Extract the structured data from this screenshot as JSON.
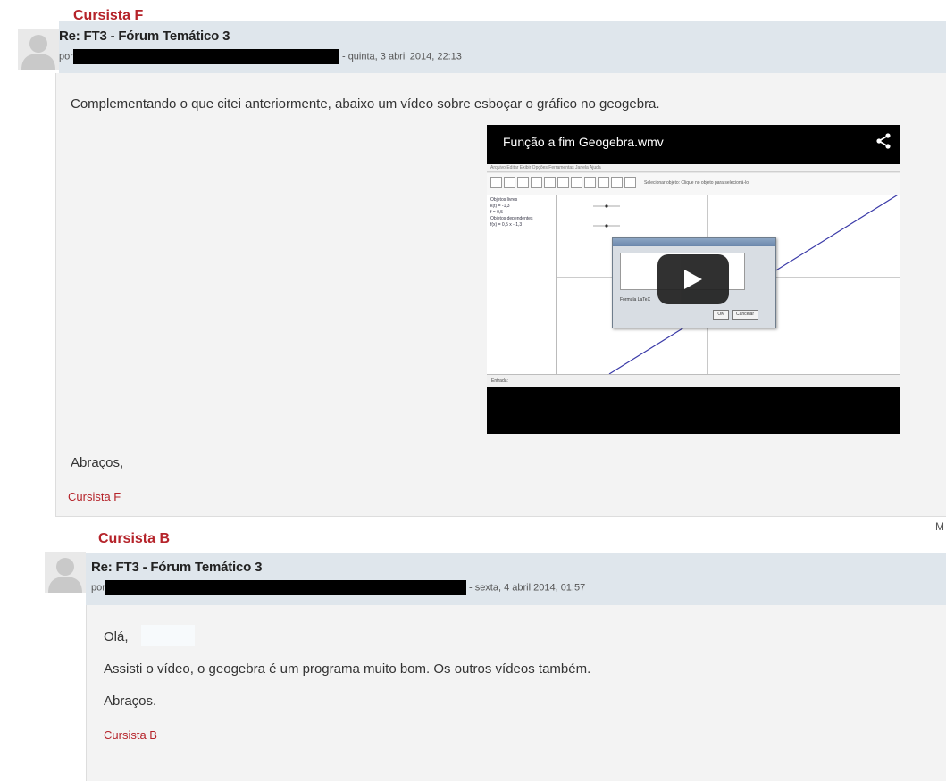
{
  "posts": [
    {
      "author_tag": "Cursista F",
      "subject": "Re: FT3 - Fórum Temático 3",
      "by_prefix": "por",
      "date": "- quinta, 3 abril 2014, 22:13",
      "paragraphs": [
        "Complementando o que citei anteriormente, abaixo um vídeo sobre esboçar o gráfico no geogebra."
      ],
      "closing": "Abraços,",
      "signature": "Cursista F",
      "video": {
        "title": "Função a fim Geogebra.wmv",
        "icon": "share-icon",
        "play_icon": "play-icon",
        "geogebra": {
          "menu": "Arquivo  Editar  Exibir  Opções  Ferramentas  Janela  Ajuda",
          "hint": "Selecionar objeto: Clique no objeto para selecioná-lo",
          "algebra_lines": [
            "Objetos livres",
            "k(t) = -1,3",
            "f = 0,5",
            "Objetos dependentes",
            "f(x) = 0,5 x - 1,3"
          ],
          "input_label": "Entrada:",
          "dialog_checkbox": "Fórmula LaTeX",
          "dialog_ok": "OK",
          "dialog_cancel": "Cancelar"
        }
      }
    },
    {
      "author_tag": "Cursista B",
      "subject": "Re: FT3 - Fórum Temático 3",
      "by_prefix": "por",
      "date": "- sexta, 4 abril 2014, 01:57",
      "paragraphs": [
        "Olá,",
        "Assisti o vídeo, o geogebra é um programa  muito bom. Os outros vídeos também.",
        "Abraços."
      ],
      "signature": "Cursista B"
    }
  ],
  "truncated_text": "M",
  "colors": {
    "author_red": "#b5232a",
    "header_bg": "#dfe6ec",
    "body_bg": "#f3f3f3",
    "redaction": "#000000"
  }
}
